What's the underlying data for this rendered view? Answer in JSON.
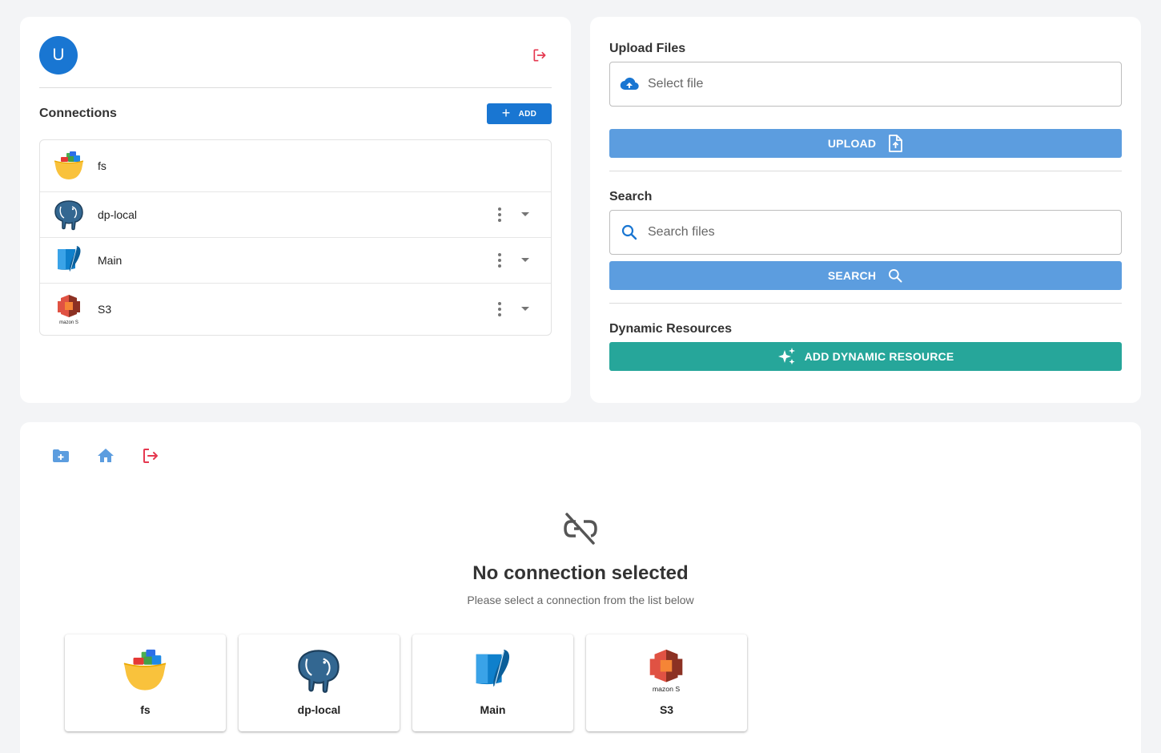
{
  "user": {
    "avatar_initial": "U"
  },
  "connections_panel": {
    "title": "Connections",
    "add_label": "ADD",
    "items": [
      {
        "name": "fs",
        "icon": "bowl-icon"
      },
      {
        "name": "dp-local",
        "icon": "postgres-elephant-icon"
      },
      {
        "name": "Main",
        "icon": "sqlite-feather-icon"
      },
      {
        "name": "S3",
        "icon": "amazon-s3-icon"
      }
    ]
  },
  "upload": {
    "title": "Upload Files",
    "placeholder": "Select file",
    "button_label": "UPLOAD"
  },
  "search": {
    "title": "Search",
    "placeholder": "Search files",
    "button_label": "SEARCH"
  },
  "dynamic": {
    "title": "Dynamic Resources",
    "button_label": "ADD DYNAMIC RESOURCE"
  },
  "browser": {
    "empty_title": "No connection selected",
    "empty_subtitle": "Please select a connection from the list below",
    "tiles": [
      {
        "name": "fs"
      },
      {
        "name": "dp-local"
      },
      {
        "name": "Main"
      },
      {
        "name": "S3"
      }
    ]
  },
  "colors": {
    "primary": "#1976d2",
    "button_light": "#5c9ddf",
    "teal": "#26a69a",
    "logout_red": "#e53950"
  }
}
